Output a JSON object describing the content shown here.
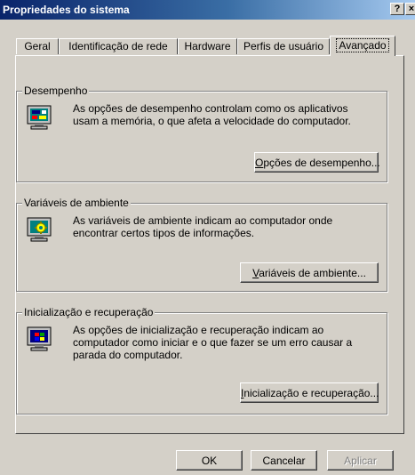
{
  "window": {
    "title": "Propriedades do sistema",
    "help_label": "?",
    "close_label": "×"
  },
  "tabs": [
    {
      "label": "Geral",
      "active": false
    },
    {
      "label": "Identificação de rede",
      "active": false
    },
    {
      "label": "Hardware",
      "active": false
    },
    {
      "label": "Perfis de usuário",
      "active": false
    },
    {
      "label": "Avançado",
      "active": true
    }
  ],
  "groups": {
    "performance": {
      "legend": "Desempenho",
      "desc_line1": "As opções de desempenho controlam como os aplicativos",
      "desc_line2": "usam a memória, o que afeta a velocidade do computador.",
      "button_hotkey": "O",
      "button_rest": "pções de desempenho...",
      "icon": "performance-monitor-icon"
    },
    "environment": {
      "legend": "Variáveis de ambiente",
      "desc_line1": "As variáveis de ambiente indicam ao computador onde",
      "desc_line2": "encontrar certos tipos de informações.",
      "button_hotkey": "V",
      "button_rest": "ariáveis de ambiente...",
      "icon": "environment-gear-monitor-icon"
    },
    "startup": {
      "legend": "Inicialização e recuperação",
      "desc_line1": "As opções de inicialização e recuperação indicam ao",
      "desc_line2": "computador como iniciar e o que fazer se um erro causar a",
      "desc_line3": "parada do computador.",
      "button_hotkey": "I",
      "button_rest": "nicialização e recuperação...",
      "icon": "windows-monitor-icon"
    }
  },
  "footer": {
    "ok_label": "OK",
    "cancel_label": "Cancelar",
    "apply_label": "Aplicar"
  },
  "colors": {
    "face": "#d4d0c8",
    "title_start": "#0a246a",
    "title_end": "#a6caf0"
  }
}
